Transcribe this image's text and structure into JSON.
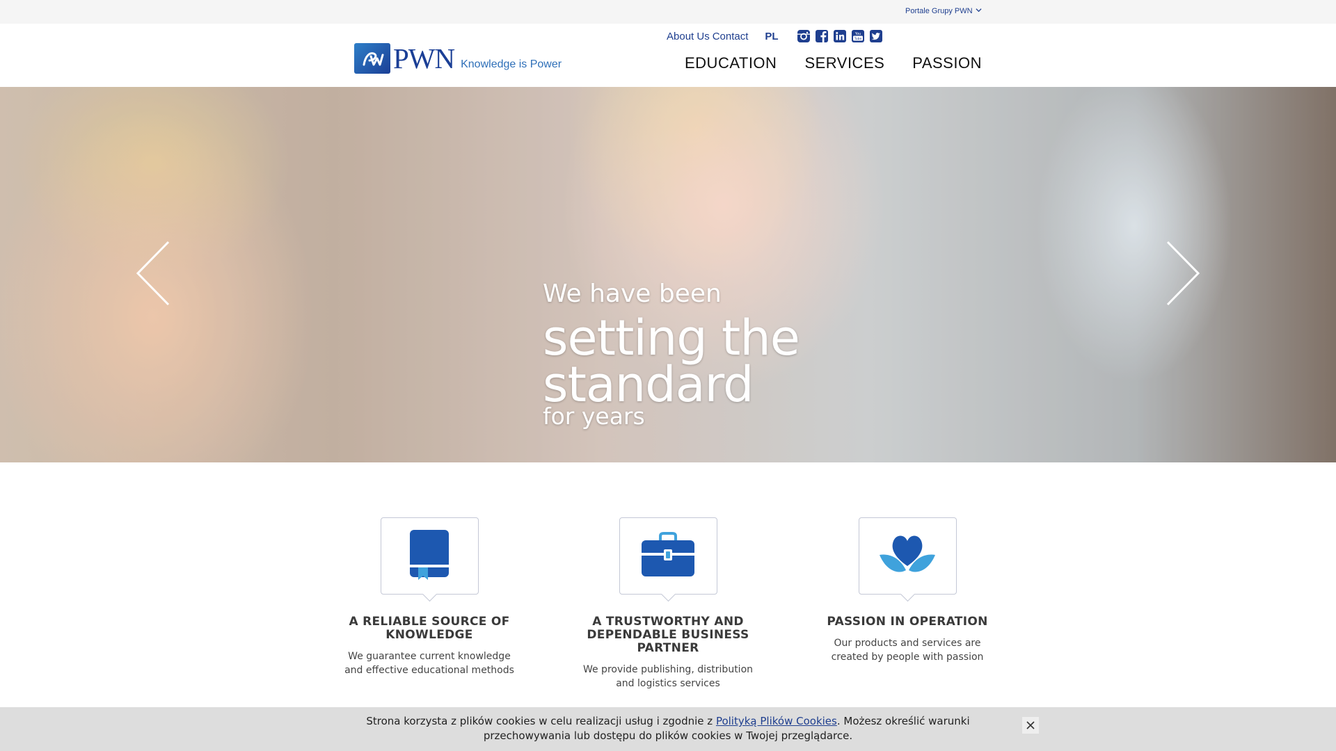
{
  "topbar": {
    "portals_label": "Portale Grupy PWN"
  },
  "header": {
    "logo_text": "PWN",
    "tagline": "Knowledge is Power",
    "utility_links": [
      "About Us",
      "Contact"
    ],
    "language": "PL",
    "social_icons": [
      "instagram-icon",
      "facebook-icon",
      "linkedin-icon",
      "youtube-icon",
      "twitter-icon"
    ],
    "nav": [
      "EDUCATION",
      "SERVICES",
      "PASSION"
    ]
  },
  "hero": {
    "line1": "We have been",
    "line2": "setting the",
    "line3": "standard",
    "line4": "for years"
  },
  "features": [
    {
      "icon": "book-icon",
      "title": "A RELIABLE SOURCE OF KNOWLEDGE",
      "text": "We guarantee current knowledge and effective educational methods"
    },
    {
      "icon": "briefcase-icon",
      "title": "A TRUSTWORTHY AND DEPENDABLE BUSINESS PARTNER",
      "text": "We provide publishing, distribution and logistics services"
    },
    {
      "icon": "heart-hands-icon",
      "title": "PASSION IN OPERATION",
      "text": "Our products and services are created by people with passion"
    }
  ],
  "cookie": {
    "text_before": "Strona korzysta z plików cookies w celu realizacji usług i zgodnie z ",
    "link": "Polityką Plików Cookies",
    "text_after": ". Możesz określić warunki przechowywania lub dostępu do plików cookies w Twojej przeglądarce."
  },
  "colors": {
    "brand_blue": "#1b3f96",
    "icon_blue": "#1d58b0",
    "accent_light_blue": "#3fa2dc"
  }
}
